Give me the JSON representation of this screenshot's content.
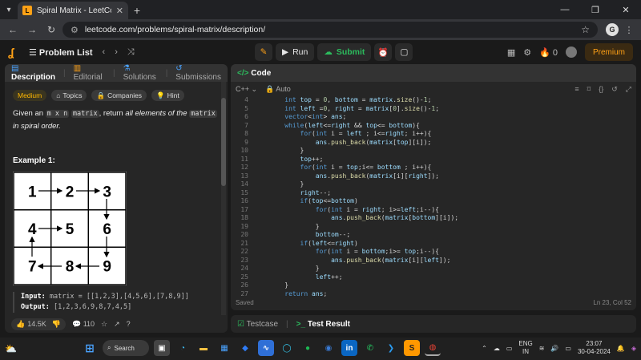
{
  "browser": {
    "tab_title": "Spiral Matrix - LeetCode",
    "url": "leetcode.com/problems/spiral-matrix/description/",
    "profile_initial": "G"
  },
  "nav": {
    "problem_list": "Problem List",
    "run": "Run",
    "submit": "Submit",
    "streak": "0",
    "premium": "Premium"
  },
  "left": {
    "tabs": [
      "Description",
      "Editorial",
      "Solutions",
      "Submissions"
    ],
    "chips": [
      "Medium",
      "Topics",
      "Companies",
      "Hint"
    ],
    "desc_pre": "Given an ",
    "desc_code1": "m x n",
    "desc_code2": "matrix",
    "desc_mid": ", return ",
    "desc_italic": "all elements of the",
    "desc_code3": "matrix",
    "desc_end": "in spiral order.",
    "example_title": "Example 1:",
    "grid": [
      "1",
      "2",
      "3",
      "4",
      "5",
      "6",
      "7",
      "8",
      "9"
    ],
    "input_label": "Input:",
    "input_value": "matrix = [[1,2,3],[4,5,6],[7,8,9]]",
    "output_label": "Output:",
    "output_value": "[1,2,3,6,9,8,7,4,5]",
    "likes": "14.5K",
    "comments": "110"
  },
  "editor": {
    "title": "Code",
    "language": "C++",
    "mode": "Auto",
    "status": "Saved",
    "cursor": "Ln 23, Col 52",
    "lines": [
      {
        "n": "4",
        "t": "    int top = 0, bottom = matrix.size()-1;"
      },
      {
        "n": "5",
        "t": "    int left =0, right = matrix[0].size()-1;"
      },
      {
        "n": "6",
        "t": "    vector<int> ans;"
      },
      {
        "n": "7",
        "t": "    while(left<=right && top<= bottom){"
      },
      {
        "n": "8",
        "t": "        for(int i = left ; i<=right; i++){"
      },
      {
        "n": "9",
        "t": "            ans.push_back(matrix[top][i]);"
      },
      {
        "n": "10",
        "t": "        }"
      },
      {
        "n": "11",
        "t": "        top++;"
      },
      {
        "n": "12",
        "t": "        for(int i = top;i<= bottom ; i++){"
      },
      {
        "n": "13",
        "t": "            ans.push_back(matrix[i][right]);"
      },
      {
        "n": "14",
        "t": "        }"
      },
      {
        "n": "15",
        "t": "        right--;"
      },
      {
        "n": "16",
        "t": "        if(top<=bottom)"
      },
      {
        "n": "17",
        "t": "            for(int i = right; i>=left;i--){"
      },
      {
        "n": "18",
        "t": "                ans.push_back(matrix[bottom][i]);"
      },
      {
        "n": "19",
        "t": "            }"
      },
      {
        "n": "20",
        "t": "            bottom--;"
      },
      {
        "n": "21",
        "t": "        if(left<=right)"
      },
      {
        "n": "22",
        "t": "            for(int i = bottom;i>= top;i--){"
      },
      {
        "n": "23",
        "t": "                ans.push_back(matrix[i][left]);"
      },
      {
        "n": "24",
        "t": "            }"
      },
      {
        "n": "25",
        "t": "            left++;"
      },
      {
        "n": "26",
        "t": "    }"
      },
      {
        "n": "27",
        "t": "    return ans;"
      }
    ]
  },
  "bottom": {
    "testcase": "Testcase",
    "test_result": "Test Result"
  },
  "taskbar": {
    "search": "Search",
    "lang1": "ENG",
    "lang2": "IN",
    "time": "23:07",
    "date": "30-04-2024"
  },
  "colors": {
    "accent": "#ffa116",
    "green": "#2cbb5d",
    "medium": "#ffb800"
  }
}
